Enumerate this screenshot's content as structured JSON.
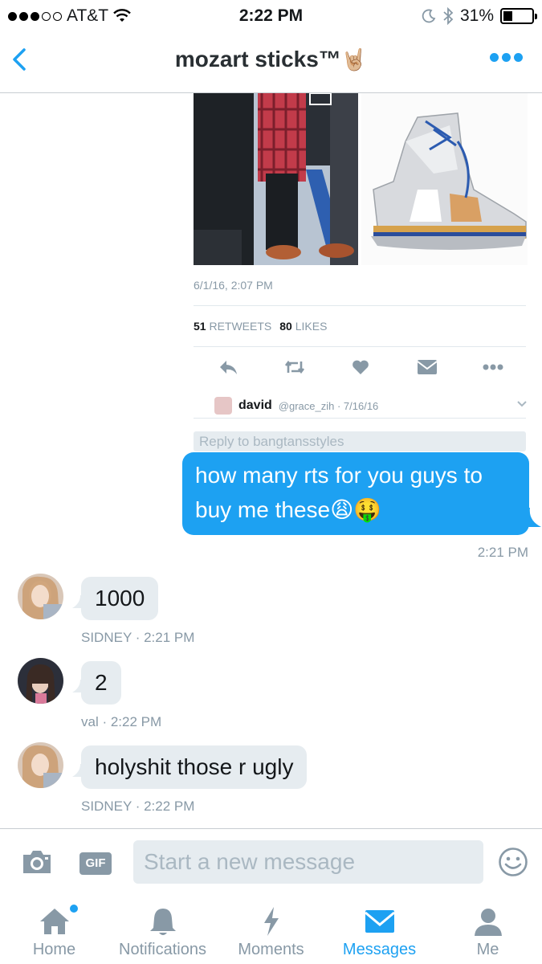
{
  "status_bar": {
    "carrier": "AT&T",
    "time": "2:22 PM",
    "battery_percent": "31%",
    "battery_level": 0.31,
    "icons": [
      "signal-icon",
      "wifi-icon",
      "moon-icon",
      "bluetooth-icon",
      "battery-icon"
    ]
  },
  "nav": {
    "title": "mozart sticks™",
    "title_emoji": "🤘🏼",
    "back_icon": "chevron-left-icon",
    "more_icon": "more-dots-icon",
    "accent": "#1da1f2"
  },
  "tweet": {
    "date": "6/1/16, 2:07 PM",
    "retweets_count": "51",
    "retweets_label": "RETWEETS",
    "likes_count": "80",
    "likes_label": "LIKES",
    "actions": [
      "reply-icon",
      "retweet-icon",
      "like-icon",
      "dm-icon",
      "more-icon"
    ],
    "reply_author": "david",
    "reply_handle_date": "@grace_zih · 7/16/16",
    "reply_placeholder": "Reply to bangtansstyles"
  },
  "messages": [
    {
      "direction": "outgoing",
      "text": "how many rts for you guys to buy me these😩🤑",
      "time": "2:21 PM"
    },
    {
      "direction": "incoming",
      "text": "1000",
      "meta": "SIDNEY · 2:21 PM"
    },
    {
      "direction": "incoming",
      "text": "2",
      "meta": "val · 2:22 PM"
    },
    {
      "direction": "incoming",
      "text": "holyshit those r ugly",
      "meta": "SIDNEY · 2:22 PM"
    }
  ],
  "compose": {
    "camera_icon": "camera-icon",
    "gif_label": "GIF",
    "placeholder": "Start a new message",
    "emoji_icon": "emoji-icon"
  },
  "tabs": [
    {
      "label": "Home",
      "icon": "home-icon",
      "active": false,
      "badge": true
    },
    {
      "label": "Notifications",
      "icon": "bell-icon",
      "active": false,
      "badge": false
    },
    {
      "label": "Moments",
      "icon": "lightning-icon",
      "active": false,
      "badge": false
    },
    {
      "label": "Messages",
      "icon": "envelope-icon",
      "active": true,
      "badge": false
    },
    {
      "label": "Me",
      "icon": "person-icon",
      "active": false,
      "badge": false
    }
  ]
}
